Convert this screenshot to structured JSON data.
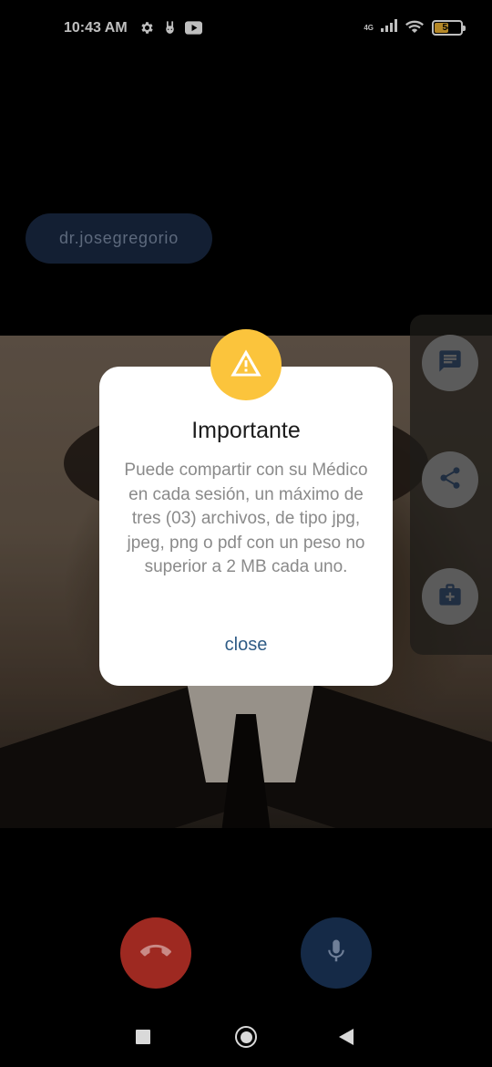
{
  "status_bar": {
    "time": "10:43 AM",
    "left_icons": [
      "gear-icon",
      "bunny-icon",
      "youtube-icon"
    ],
    "network_label": "4G",
    "battery_level": "54",
    "battery_color": "#f2b634"
  },
  "call": {
    "doctor_name": "dr.josegregorio"
  },
  "side_actions": [
    {
      "icon": "chat-icon"
    },
    {
      "icon": "share-icon"
    },
    {
      "icon": "medical-kit-icon"
    }
  ],
  "dialog": {
    "icon": "warning-icon",
    "title": "Importante",
    "message": "Puede compartir con su Médico en cada sesión, un máximo de tres (03) archivos, de tipo jpg, jpeg, png o pdf con un peso no superior a 2 MB cada uno.",
    "close_label": "close",
    "accent_color": "#fbc43c"
  },
  "controls": {
    "end_call_icon": "end-call-icon",
    "end_call_color": "#9e2921",
    "mic_icon": "microphone-icon",
    "mic_color": "#152a47"
  },
  "nav_bar": {
    "items": [
      "recents-icon",
      "home-icon",
      "back-icon"
    ]
  }
}
